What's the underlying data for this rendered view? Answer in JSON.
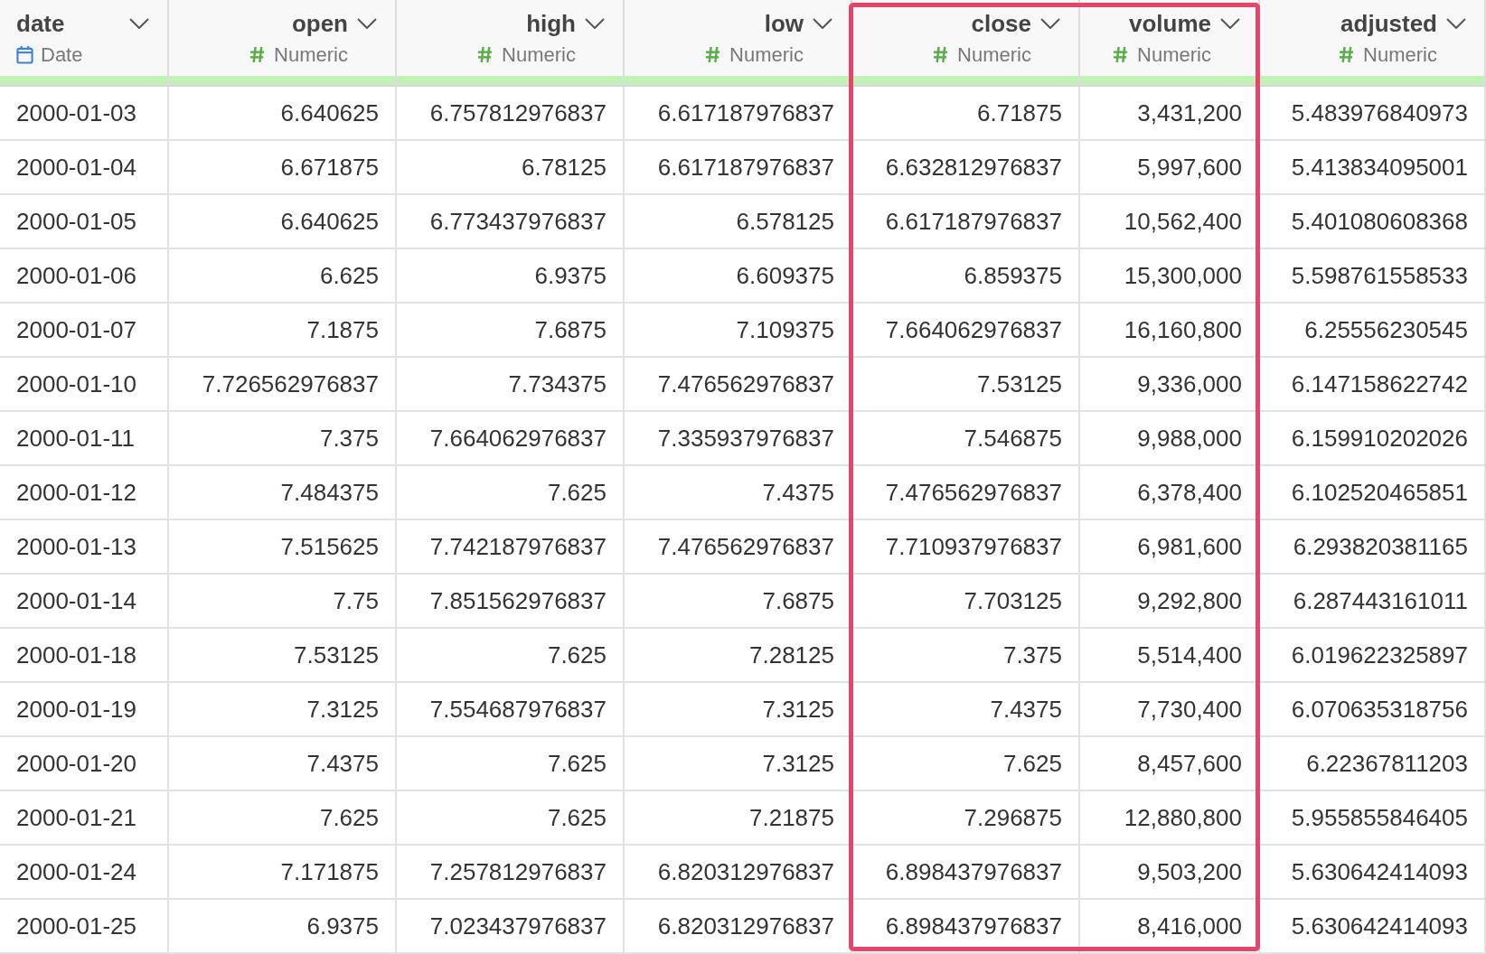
{
  "columns": [
    {
      "name": "date",
      "type": "Date",
      "kind": "date",
      "selected": false
    },
    {
      "name": "open",
      "type": "Numeric",
      "kind": "numeric",
      "selected": false
    },
    {
      "name": "high",
      "type": "Numeric",
      "kind": "numeric",
      "selected": false
    },
    {
      "name": "low",
      "type": "Numeric",
      "kind": "numeric",
      "selected": false
    },
    {
      "name": "close",
      "type": "Numeric",
      "kind": "numeric",
      "selected": true
    },
    {
      "name": "volume",
      "type": "Numeric",
      "kind": "numeric",
      "selected": true
    },
    {
      "name": "adjusted",
      "type": "Numeric",
      "kind": "numeric",
      "selected": false
    }
  ],
  "rows": [
    [
      "2000-01-03",
      "6.640625",
      "6.757812976837",
      "6.617187976837",
      "6.71875",
      "3,431,200",
      "5.483976840973"
    ],
    [
      "2000-01-04",
      "6.671875",
      "6.78125",
      "6.617187976837",
      "6.632812976837",
      "5,997,600",
      "5.413834095001"
    ],
    [
      "2000-01-05",
      "6.640625",
      "6.773437976837",
      "6.578125",
      "6.617187976837",
      "10,562,400",
      "5.401080608368"
    ],
    [
      "2000-01-06",
      "6.625",
      "6.9375",
      "6.609375",
      "6.859375",
      "15,300,000",
      "5.598761558533"
    ],
    [
      "2000-01-07",
      "7.1875",
      "7.6875",
      "7.109375",
      "7.664062976837",
      "16,160,800",
      "6.25556230545"
    ],
    [
      "2000-01-10",
      "7.726562976837",
      "7.734375",
      "7.476562976837",
      "7.53125",
      "9,336,000",
      "6.147158622742"
    ],
    [
      "2000-01-11",
      "7.375",
      "7.664062976837",
      "7.335937976837",
      "7.546875",
      "9,988,000",
      "6.159910202026"
    ],
    [
      "2000-01-12",
      "7.484375",
      "7.625",
      "7.4375",
      "7.476562976837",
      "6,378,400",
      "6.102520465851"
    ],
    [
      "2000-01-13",
      "7.515625",
      "7.742187976837",
      "7.476562976837",
      "7.710937976837",
      "6,981,600",
      "6.293820381165"
    ],
    [
      "2000-01-14",
      "7.75",
      "7.851562976837",
      "7.6875",
      "7.703125",
      "9,292,800",
      "6.287443161011"
    ],
    [
      "2000-01-18",
      "7.53125",
      "7.625",
      "7.28125",
      "7.375",
      "5,514,400",
      "6.019622325897"
    ],
    [
      "2000-01-19",
      "7.3125",
      "7.554687976837",
      "7.3125",
      "7.4375",
      "7,730,400",
      "6.070635318756"
    ],
    [
      "2000-01-20",
      "7.4375",
      "7.625",
      "7.3125",
      "7.625",
      "8,457,600",
      "6.22367811203"
    ],
    [
      "2000-01-21",
      "7.625",
      "7.625",
      "7.21875",
      "7.296875",
      "12,880,800",
      "5.955855846405"
    ],
    [
      "2000-01-24",
      "7.171875",
      "7.257812976837",
      "6.820312976837",
      "6.898437976837",
      "9,503,200",
      "5.630642414093"
    ],
    [
      "2000-01-25",
      "6.9375",
      "7.023437976837",
      "6.820312976837",
      "6.898437976837",
      "8,416,000",
      "5.630642414093"
    ]
  ]
}
